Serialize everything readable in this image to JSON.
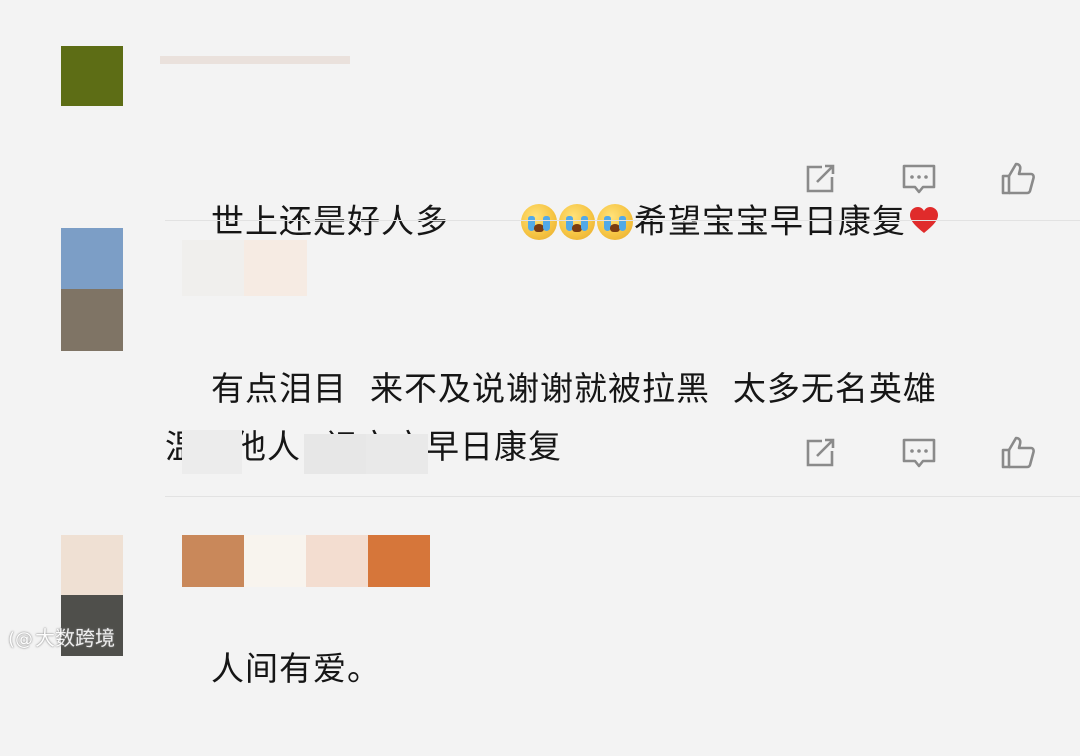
{
  "comments": [
    {
      "text": "世上还是好人多",
      "emoji_names": [
        "crying-face-icon",
        "crying-face-icon",
        "crying-face-icon"
      ],
      "text_after": "希望宝宝早日康复",
      "end_icon": "red-heart-icon"
    },
    {
      "text": "有点泪目  来不及说谢谢就被拉黑  太多无名英雄\n温暖他人  祝宝宝早日康复"
    },
    {
      "text": "人间有爱。"
    }
  ],
  "actions": [
    "share-icon",
    "comment-icon",
    "like-icon"
  ],
  "watermark": {
    "logo": "(@",
    "text": "大数跨境"
  },
  "colors": {
    "background": "#f3f3f3",
    "icon": "#8a8a8a",
    "heart": "#e02b2b"
  }
}
